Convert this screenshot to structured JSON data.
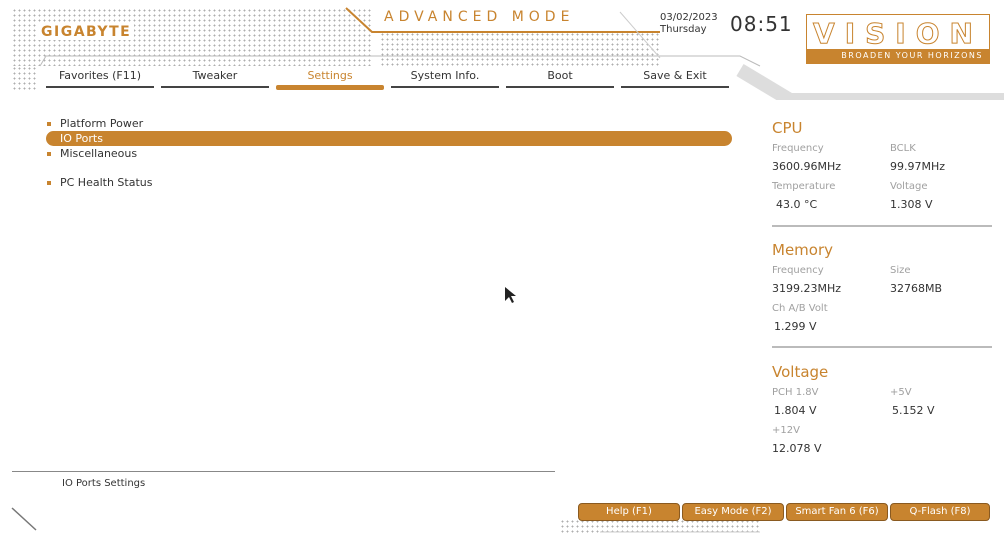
{
  "header": {
    "brand": "GIGABYTE",
    "mode": "ADVANCED MODE",
    "date": "03/02/2023",
    "day": "Thursday",
    "time": "08:51",
    "vision_logo": "VISION",
    "vision_tagline": "BROADEN YOUR HORIZONS"
  },
  "tabs": [
    {
      "label": "Favorites (F11)",
      "active": false
    },
    {
      "label": "Tweaker",
      "active": false
    },
    {
      "label": "Settings",
      "active": true
    },
    {
      "label": "System Info.",
      "active": false
    },
    {
      "label": "Boot",
      "active": false
    },
    {
      "label": "Save & Exit",
      "active": false
    }
  ],
  "menu": [
    {
      "label": "Platform Power"
    },
    {
      "label": "IO Ports",
      "selected": true
    },
    {
      "label": "Miscellaneous"
    },
    {
      "label": "PC Health Status"
    }
  ],
  "help_text": "IO Ports Settings",
  "sidebar": {
    "cpu": {
      "title": "CPU",
      "frequency_label": "Frequency",
      "frequency": "3600.96MHz",
      "bclk_label": "BCLK",
      "bclk": "99.97MHz",
      "temperature_label": "Temperature",
      "temperature": "43.0 °C",
      "voltage_label": "Voltage",
      "voltage": "1.308 V"
    },
    "memory": {
      "title": "Memory",
      "frequency_label": "Frequency",
      "frequency": "3199.23MHz",
      "size_label": "Size",
      "size": "32768MB",
      "volt_label": "Ch A/B Volt",
      "volt": "1.299 V"
    },
    "voltage": {
      "title": "Voltage",
      "pch_label": "PCH 1.8V",
      "pch": "1.804 V",
      "v5_label": "+5V",
      "v5": "5.152 V",
      "v12_label": "+12V",
      "v12": "12.078 V"
    }
  },
  "buttons": {
    "help": "Help (F1)",
    "easy_mode": "Easy Mode (F2)",
    "smart_fan": "Smart Fan 6 (F6)",
    "qflash": "Q-Flash (F8)"
  },
  "colors": {
    "accent": "#c8842f",
    "text": "#333333"
  },
  "icons": [
    "mouse-cursor-icon"
  ]
}
